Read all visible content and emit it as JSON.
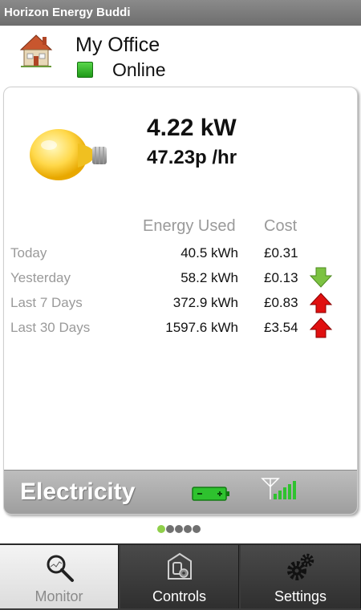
{
  "app": {
    "title": "Horizon Energy Buddi"
  },
  "device": {
    "name": "My Office",
    "status": "Online",
    "status_color": "#2db02a",
    "icon": "house-icon"
  },
  "summary": {
    "power": "4.22 kW",
    "rate": "47.23p /hr",
    "icon": "lightbulb-icon"
  },
  "table": {
    "headers": {
      "energy": "Energy Used",
      "cost": "Cost"
    },
    "rows": [
      {
        "label": "Today",
        "energy": "40.5 kWh",
        "cost": "£0.31",
        "trend": "none"
      },
      {
        "label": "Yesterday",
        "energy": "58.2 kWh",
        "cost": "£0.13",
        "trend": "down"
      },
      {
        "label": "Last 7 Days",
        "energy": "372.9 kWh",
        "cost": "£0.83",
        "trend": "up"
      },
      {
        "label": "Last 30 Days",
        "energy": "1597.6 kWh",
        "cost": "£3.54",
        "trend": "up"
      }
    ],
    "trend_colors": {
      "down": "#7cc242",
      "up": "#e01010"
    }
  },
  "footer": {
    "title": "Electricity",
    "icons": [
      "battery-icon",
      "signal-strength-icon"
    ]
  },
  "pager": {
    "count": 5,
    "active_index": 0,
    "active_color": "#8fcf4a"
  },
  "tabs": [
    {
      "label": "Monitor",
      "icon": "magnifier-icon",
      "selected": true
    },
    {
      "label": "Controls",
      "icon": "device-settings-icon",
      "selected": false
    },
    {
      "label": "Settings",
      "icon": "gears-icon",
      "selected": false
    }
  ]
}
